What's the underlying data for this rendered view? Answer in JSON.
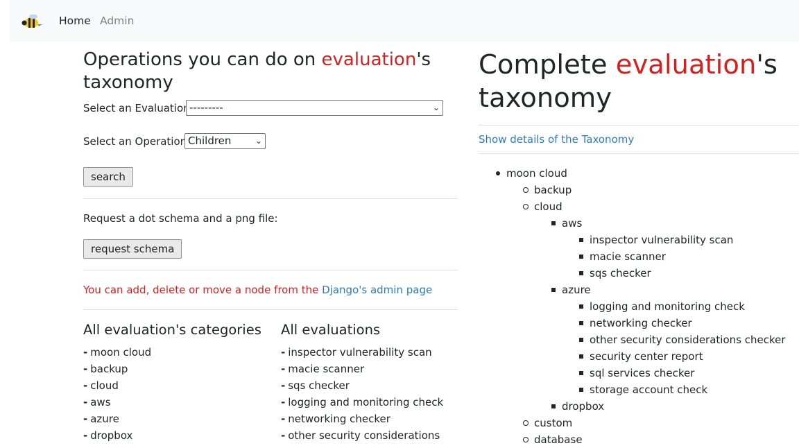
{
  "nav": {
    "logo_icon": "bee-logo-icon",
    "home": "Home",
    "admin": "Admin"
  },
  "left": {
    "title_pre": "Operations you can do on ",
    "title_highlight": "evaluation",
    "title_post": "'s taxonomy",
    "select_evaluation_label": "Select an Evaluation:",
    "select_evaluation_value": "---------",
    "select_operation_label": "Select an Operation:",
    "select_operation_value": "Children",
    "search_button": "search",
    "schema_text": "Request a dot schema and a png file:",
    "schema_button": "request schema",
    "admin_note_pre": "You can add, delete or move a node from the ",
    "admin_note_link": "Django's admin page",
    "categories_title": "All evaluation's categories",
    "categories": [
      "moon cloud",
      "backup",
      "cloud",
      "aws",
      "azure",
      "dropbox"
    ],
    "evaluations_title": "All evaluations",
    "evaluations": [
      "inspector vulnerability scan",
      "macie scanner",
      "sqs checker",
      "logging and monitoring check",
      "networking checker",
      "other security considerations"
    ],
    "dash": "-"
  },
  "right": {
    "title_pre": "Complete ",
    "title_highlight": "evaluation",
    "title_post": "'s taxonomy",
    "details_link": "Show details of the Taxonomy",
    "tree": {
      "root": "moon cloud",
      "backup": "backup",
      "cloud": "cloud",
      "aws": "aws",
      "aws_items": [
        "inspector vulnerability scan",
        "macie scanner",
        "sqs checker"
      ],
      "azure": "azure",
      "azure_items": [
        "logging and monitoring check",
        "networking checker",
        "other security considerations checker",
        "security center report",
        "sql services checker",
        "storage account check"
      ],
      "dropbox": "dropbox",
      "custom": "custom",
      "database": "database"
    }
  },
  "colors": {
    "accent_red": "#dc1d1d",
    "link_blue": "#2b7bc0",
    "navbar_bg": "#f8f9fa"
  }
}
